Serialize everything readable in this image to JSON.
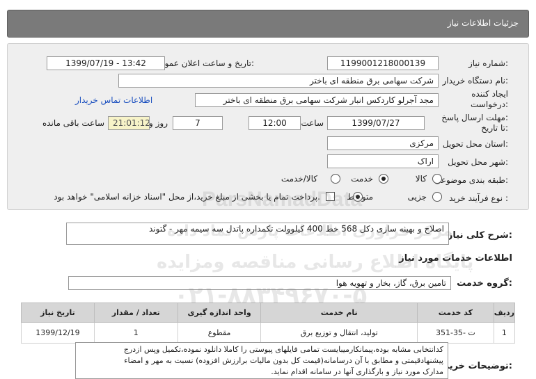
{
  "header": {
    "title": "جزئیات اطلاعات نیاز"
  },
  "form": {
    "need_number_label": "شماره نیاز:",
    "need_number": "1199001218000139",
    "announce_label": "تاریخ و ساعت اعلان عمومی:",
    "announce_value": "1399/07/19 - 13:42",
    "buyer_label": "نام دستگاه خریدار:",
    "buyer_value": "شرکت سهامی برق منطقه ای باختر",
    "creator_label_1": "ایجاد کننده",
    "creator_label_2": "درخواست:",
    "creator_value": "مجد آجرلو کاردکس انبار شرکت سهامی برق منطقه ای باختر",
    "contact_link": "اطلاعات تماس خریدار",
    "deadline_label_1": "مهلت ارسال پاسخ:",
    "deadline_label_2": "تا تاریخ:",
    "deadline_date": "1399/07/27",
    "time_label": "ساعت",
    "deadline_time": "12:00",
    "days_value": "7",
    "days_label": "روز و",
    "remaining_time": "21:01:12",
    "remaining_label": "ساعت باقی مانده",
    "province_label": "استان محل تحویل:",
    "province_value": "مرکزی",
    "city_label": "شهر محل تحویل:",
    "city_value": "اراک",
    "category_label": "طبقه بندی موضوعی:",
    "category_options": [
      "کالا",
      "خدمت",
      "کالا/خدمت"
    ],
    "category_selected": "خدمت",
    "process_label": "نوع فرآیند خرید :",
    "process_options": [
      "جزیی",
      "متوسط"
    ],
    "process_selected": "متوسط",
    "payment_note": "پرداخت تمام یا بخشی از مبلغ خرید،از محل \"اسناد خزانه اسلامی\" خواهد بود."
  },
  "summary": {
    "label": "شرح کلی نیاز:",
    "value": "اصلاح و بهینه سازی دکل 568 خط 400 کیلوولت تکمداره پاتدل سه سیمه مهر - گتوند"
  },
  "services": {
    "section_title": "اطلاعات خدمات مورد نیاز",
    "group_label": "گروه خدمت:",
    "group_value": "تامین برق، گاز، بخار و تهویه هوا",
    "columns": [
      "ردیف",
      "کد خدمت",
      "نام خدمت",
      "واحد اندازه گیری",
      "تعداد / مقدار",
      "تاریخ نیاز"
    ],
    "rows": [
      [
        "1",
        "ت -35-351",
        "تولید، انتقال و توزیع برق",
        "مقطوع",
        "1",
        "1399/12/19"
      ]
    ]
  },
  "buyer_notes": {
    "label": "توضیحات خریدار:",
    "lines": [
      "کدانتخابی مشابه بوده،پیمانکارمیبایست تمامی فایلهای پیوستی را کاملا دانلود نموده،تکمیل وپس ازدرج",
      "پیشنهادقیمتی و مطابق با آن درسامانه(قیمت کل بدون مالیات برارزش افزوده) نسبت به مهر و امضاء",
      "مدارک مورد نیاز و بارگذاری آنها در سامانه اقدام نماید."
    ]
  },
  "watermark": {
    "brand": "ParsNamadData",
    "line1": "مرکز فراوری اطلاعات پارس نماد داده",
    "line2": "پایگاه اطلاع رسانی مناقصه ومزایده",
    "phone": "۰۲۱-۸۸۳۴۹۶۷۰-۵"
  }
}
